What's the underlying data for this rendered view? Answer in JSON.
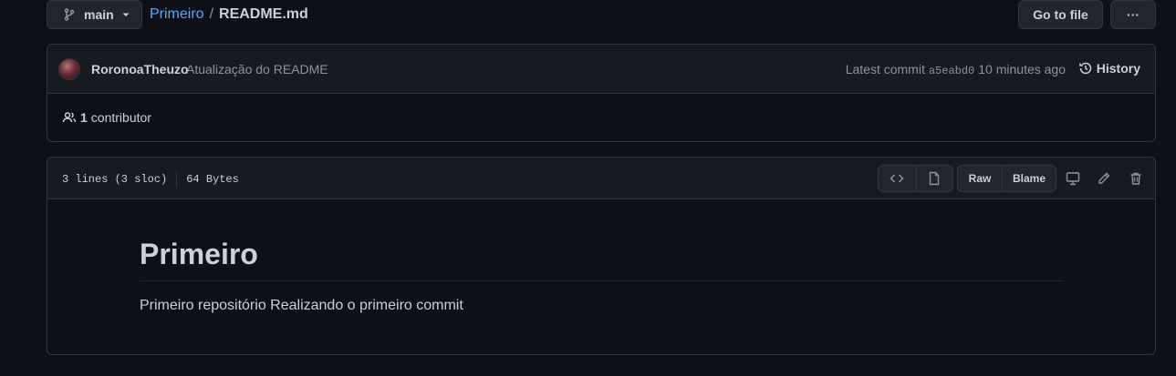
{
  "topbar": {
    "branch": "main",
    "repo": "Primeiro",
    "separator": "/",
    "file": "README.md",
    "go_to_file": "Go to file",
    "more": "···"
  },
  "commit": {
    "author": "RoronoaTheuzo",
    "message": "Atualização do README",
    "latest_label": "Latest commit",
    "sha": "a5eabd0",
    "time": "10 minutes ago",
    "history_label": "History"
  },
  "contributors": {
    "count": "1",
    "label": "contributor"
  },
  "file": {
    "lines": "3 lines (3 sloc)",
    "size": "64 Bytes",
    "raw_label": "Raw",
    "blame_label": "Blame"
  },
  "readme": {
    "heading": "Primeiro",
    "body": "Primeiro repositório Realizando o primeiro commit"
  },
  "colors": {
    "background": "#0d1117",
    "header_bg": "#161b22",
    "border": "#30363d",
    "link": "#58a6ff",
    "text": "#c9d1d9",
    "muted": "#8b949e"
  }
}
